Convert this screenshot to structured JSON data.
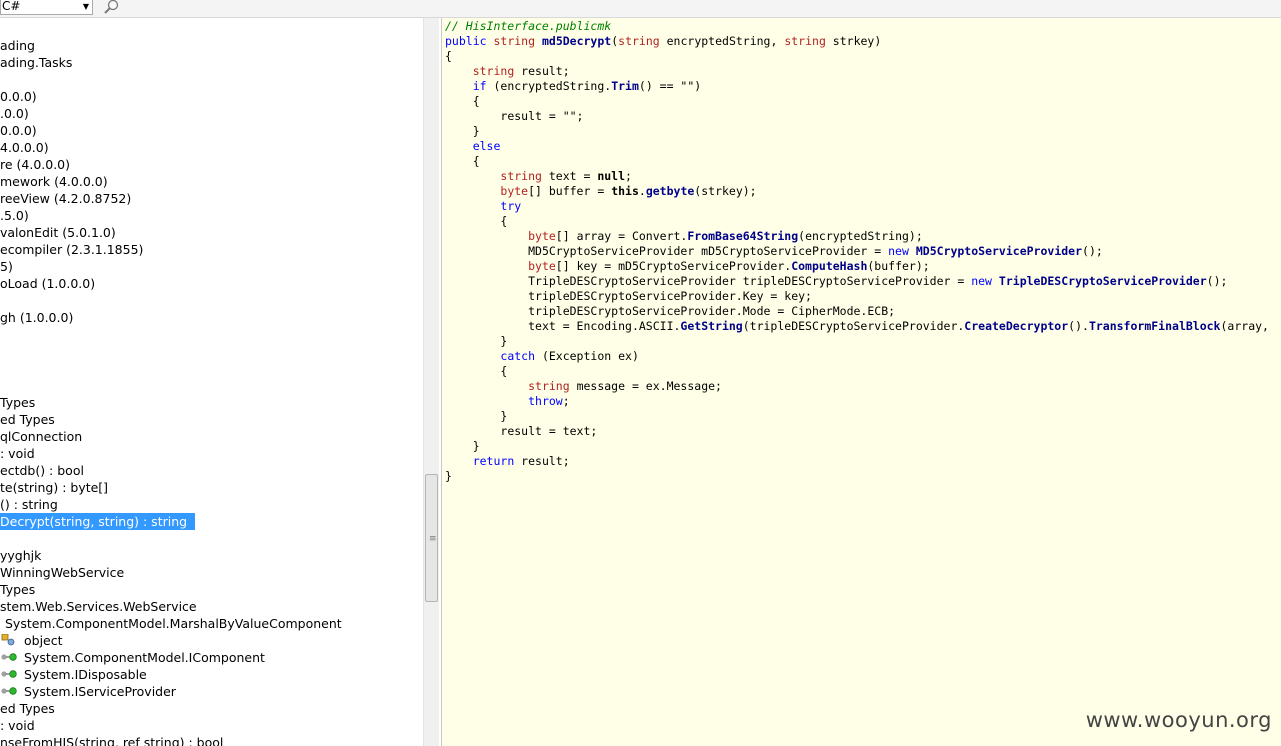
{
  "toolbar": {
    "language_value": "C#",
    "search_icon": "magnifier-icon"
  },
  "tree": {
    "items": [
      {
        "label": "ading"
      },
      {
        "label": "ading.Tasks"
      },
      {
        "label": "0.0.0)"
      },
      {
        "label": ".0.0)"
      },
      {
        "label": "0.0.0)"
      },
      {
        "label": "4.0.0.0)"
      },
      {
        "label": "re (4.0.0.0)"
      },
      {
        "label": "mework (4.0.0.0)"
      },
      {
        "label": "reeView (4.2.0.8752)"
      },
      {
        "label": ".5.0)"
      },
      {
        "label": "valonEdit (5.0.1.0)"
      },
      {
        "label": "ecompiler (2.3.1.1855)"
      },
      {
        "label": "5)"
      },
      {
        "label": "oLoad (1.0.0.0)"
      },
      {
        "label": "gh (1.0.0.0)"
      },
      {
        "label": "Types"
      },
      {
        "label": "ed Types"
      },
      {
        "label": "qlConnection"
      },
      {
        "label": " : void"
      },
      {
        "label": "ectdb() : bool"
      },
      {
        "label": "te(string) : byte[]"
      },
      {
        "label": "() : string"
      },
      {
        "label": "Decrypt(string, string) : string"
      },
      {
        "label": "yyghjk"
      },
      {
        "label": "WinningWebService"
      },
      {
        "label": "Types"
      },
      {
        "label": "stem.Web.Services.WebService"
      },
      {
        "label": "System.ComponentModel.MarshalByValueComponent"
      },
      {
        "label": "object"
      },
      {
        "label": "System.ComponentModel.IComponent"
      },
      {
        "label": "System.IDisposable"
      },
      {
        "label": "System.IServiceProvider"
      },
      {
        "label": "ed Types"
      },
      {
        "label": " : void"
      },
      {
        "label": "nseFromHIS(string, ref string) : bool"
      }
    ]
  },
  "code": {
    "comment": "// HisInterface.publicmk",
    "signature": {
      "kw_public": "public",
      "kw_string": "string",
      "method_name": "md5Decrypt",
      "open_paren": "(",
      "param1_type": "string",
      "param1_name": " encryptedString, ",
      "param2_type": "string",
      "param2_name": " strkey)"
    },
    "l_brace": "{",
    "r_brace": "}",
    "line_result_decl": {
      "type": "string",
      "rest": " result;"
    },
    "line_if": {
      "kw": "if",
      "pre": " (encryptedString.",
      "method": "Trim",
      "post": "() == \"\")"
    },
    "line_result_empty": "result = \"\";",
    "kw_else": "else",
    "line_text_decl": {
      "type": "string",
      "mid": " text = ",
      "kw_null": "null",
      "end": ";"
    },
    "line_buffer": {
      "type": "byte",
      "mid": "[] buffer = ",
      "kw_this": "this",
      "dot": ".",
      "method": "getbyte",
      "end": "(strkey);"
    },
    "kw_try": "try",
    "line_array": {
      "type": "byte",
      "mid": "[] array = Convert.",
      "method": "FromBase64String",
      "end": "(encryptedString);"
    },
    "line_md5": {
      "pre": "MD5CryptoServiceProvider mD5CryptoServiceProvider = ",
      "kw_new": "new",
      "space": " ",
      "ctor": "MD5CryptoServiceProvider",
      "end": "();"
    },
    "line_key": {
      "type": "byte",
      "mid": "[] key = mD5CryptoServiceProvider.",
      "method": "ComputeHash",
      "end": "(buffer);"
    },
    "line_tdes": {
      "pre": "TripleDESCryptoServiceProvider tripleDESCryptoServiceProvider = ",
      "kw_new": "new",
      "space": " ",
      "ctor": "TripleDESCryptoServiceProvider",
      "end": "();"
    },
    "line_setkey": "tripleDESCryptoServiceProvider.Key = key;",
    "line_setmode": "tripleDESCryptoServiceProvider.Mode = CipherMode.ECB;",
    "line_text_assign": {
      "pre": "text = Encoding.ASCII.",
      "m1": "GetString",
      "mid": "(tripleDESCryptoServiceProvider.",
      "m2": "CreateDecryptor",
      "mid2": "().",
      "m3": "TransformFinalBlock",
      "end": "(array,"
    },
    "line_catch": {
      "kw": "catch",
      "rest": " (Exception ex)"
    },
    "line_message": {
      "type": "string",
      "rest": " message = ex.Message;"
    },
    "line_throw": {
      "kw": "throw",
      "rest": ";"
    },
    "line_result_text": "result = text;",
    "line_return": {
      "kw": "return",
      "rest": " result;"
    }
  },
  "watermark": "www.wooyun.org"
}
